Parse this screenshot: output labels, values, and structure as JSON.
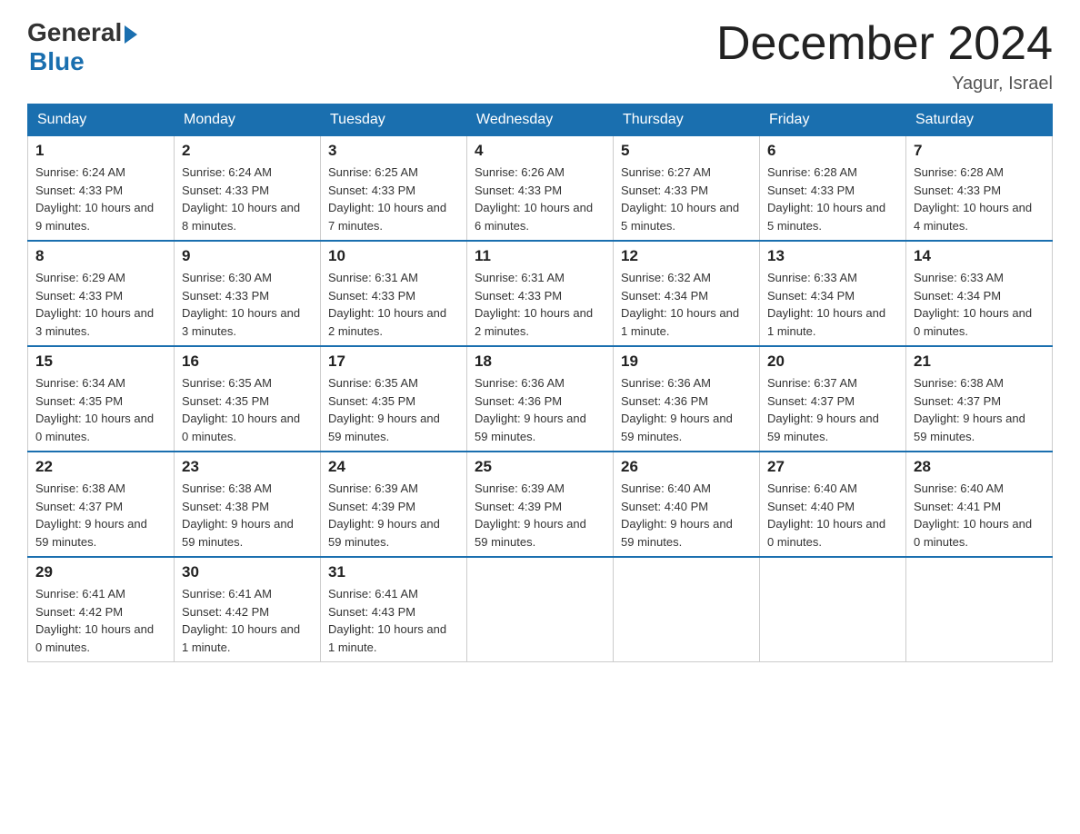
{
  "logo": {
    "general": "General",
    "blue": "Blue"
  },
  "title": "December 2024",
  "location": "Yagur, Israel",
  "days_of_week": [
    "Sunday",
    "Monday",
    "Tuesday",
    "Wednesday",
    "Thursday",
    "Friday",
    "Saturday"
  ],
  "weeks": [
    [
      {
        "day": "1",
        "sunrise": "6:24 AM",
        "sunset": "4:33 PM",
        "daylight": "10 hours and 9 minutes."
      },
      {
        "day": "2",
        "sunrise": "6:24 AM",
        "sunset": "4:33 PM",
        "daylight": "10 hours and 8 minutes."
      },
      {
        "day": "3",
        "sunrise": "6:25 AM",
        "sunset": "4:33 PM",
        "daylight": "10 hours and 7 minutes."
      },
      {
        "day": "4",
        "sunrise": "6:26 AM",
        "sunset": "4:33 PM",
        "daylight": "10 hours and 6 minutes."
      },
      {
        "day": "5",
        "sunrise": "6:27 AM",
        "sunset": "4:33 PM",
        "daylight": "10 hours and 5 minutes."
      },
      {
        "day": "6",
        "sunrise": "6:28 AM",
        "sunset": "4:33 PM",
        "daylight": "10 hours and 5 minutes."
      },
      {
        "day": "7",
        "sunrise": "6:28 AM",
        "sunset": "4:33 PM",
        "daylight": "10 hours and 4 minutes."
      }
    ],
    [
      {
        "day": "8",
        "sunrise": "6:29 AM",
        "sunset": "4:33 PM",
        "daylight": "10 hours and 3 minutes."
      },
      {
        "day": "9",
        "sunrise": "6:30 AM",
        "sunset": "4:33 PM",
        "daylight": "10 hours and 3 minutes."
      },
      {
        "day": "10",
        "sunrise": "6:31 AM",
        "sunset": "4:33 PM",
        "daylight": "10 hours and 2 minutes."
      },
      {
        "day": "11",
        "sunrise": "6:31 AM",
        "sunset": "4:33 PM",
        "daylight": "10 hours and 2 minutes."
      },
      {
        "day": "12",
        "sunrise": "6:32 AM",
        "sunset": "4:34 PM",
        "daylight": "10 hours and 1 minute."
      },
      {
        "day": "13",
        "sunrise": "6:33 AM",
        "sunset": "4:34 PM",
        "daylight": "10 hours and 1 minute."
      },
      {
        "day": "14",
        "sunrise": "6:33 AM",
        "sunset": "4:34 PM",
        "daylight": "10 hours and 0 minutes."
      }
    ],
    [
      {
        "day": "15",
        "sunrise": "6:34 AM",
        "sunset": "4:35 PM",
        "daylight": "10 hours and 0 minutes."
      },
      {
        "day": "16",
        "sunrise": "6:35 AM",
        "sunset": "4:35 PM",
        "daylight": "10 hours and 0 minutes."
      },
      {
        "day": "17",
        "sunrise": "6:35 AM",
        "sunset": "4:35 PM",
        "daylight": "9 hours and 59 minutes."
      },
      {
        "day": "18",
        "sunrise": "6:36 AM",
        "sunset": "4:36 PM",
        "daylight": "9 hours and 59 minutes."
      },
      {
        "day": "19",
        "sunrise": "6:36 AM",
        "sunset": "4:36 PM",
        "daylight": "9 hours and 59 minutes."
      },
      {
        "day": "20",
        "sunrise": "6:37 AM",
        "sunset": "4:37 PM",
        "daylight": "9 hours and 59 minutes."
      },
      {
        "day": "21",
        "sunrise": "6:38 AM",
        "sunset": "4:37 PM",
        "daylight": "9 hours and 59 minutes."
      }
    ],
    [
      {
        "day": "22",
        "sunrise": "6:38 AM",
        "sunset": "4:37 PM",
        "daylight": "9 hours and 59 minutes."
      },
      {
        "day": "23",
        "sunrise": "6:38 AM",
        "sunset": "4:38 PM",
        "daylight": "9 hours and 59 minutes."
      },
      {
        "day": "24",
        "sunrise": "6:39 AM",
        "sunset": "4:39 PM",
        "daylight": "9 hours and 59 minutes."
      },
      {
        "day": "25",
        "sunrise": "6:39 AM",
        "sunset": "4:39 PM",
        "daylight": "9 hours and 59 minutes."
      },
      {
        "day": "26",
        "sunrise": "6:40 AM",
        "sunset": "4:40 PM",
        "daylight": "9 hours and 59 minutes."
      },
      {
        "day": "27",
        "sunrise": "6:40 AM",
        "sunset": "4:40 PM",
        "daylight": "10 hours and 0 minutes."
      },
      {
        "day": "28",
        "sunrise": "6:40 AM",
        "sunset": "4:41 PM",
        "daylight": "10 hours and 0 minutes."
      }
    ],
    [
      {
        "day": "29",
        "sunrise": "6:41 AM",
        "sunset": "4:42 PM",
        "daylight": "10 hours and 0 minutes."
      },
      {
        "day": "30",
        "sunrise": "6:41 AM",
        "sunset": "4:42 PM",
        "daylight": "10 hours and 1 minute."
      },
      {
        "day": "31",
        "sunrise": "6:41 AM",
        "sunset": "4:43 PM",
        "daylight": "10 hours and 1 minute."
      },
      null,
      null,
      null,
      null
    ]
  ],
  "labels": {
    "sunrise": "Sunrise:",
    "sunset": "Sunset:",
    "daylight": "Daylight:"
  }
}
